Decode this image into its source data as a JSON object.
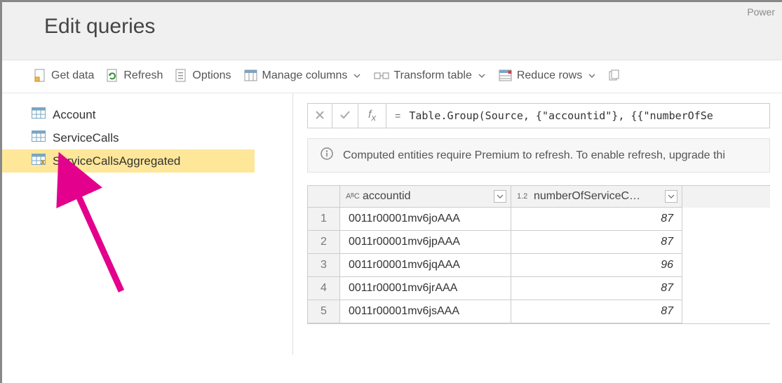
{
  "header": {
    "title": "Edit queries",
    "brand": "Power"
  },
  "toolbar": {
    "get_data": "Get data",
    "refresh": "Refresh",
    "options": "Options",
    "manage_columns": "Manage columns",
    "transform_table": "Transform table",
    "reduce_rows": "Reduce rows"
  },
  "sidebar": {
    "items": [
      {
        "label": "Account"
      },
      {
        "label": "ServiceCalls"
      },
      {
        "label": "ServiceCallsAggregated"
      }
    ],
    "selected_index": 2
  },
  "formula": {
    "eq": "=",
    "text": "Table.Group(Source, {\"accountid\"}, {{\"numberOfSe"
  },
  "info_banner": {
    "text": "Computed entities require Premium to refresh. To enable refresh, upgrade thi"
  },
  "table": {
    "columns": [
      {
        "type_label": "AᴮC",
        "name": "accountid"
      },
      {
        "type_label": "1.2",
        "name": "numberOfServiceC…"
      }
    ],
    "rows": [
      {
        "n": 1,
        "accountid": "0011r00001mv6joAAA",
        "value": 87
      },
      {
        "n": 2,
        "accountid": "0011r00001mv6jpAAA",
        "value": 87
      },
      {
        "n": 3,
        "accountid": "0011r00001mv6jqAAA",
        "value": 96
      },
      {
        "n": 4,
        "accountid": "0011r00001mv6jrAAA",
        "value": 87
      },
      {
        "n": 5,
        "accountid": "0011r00001mv6jsAAA",
        "value": 87
      }
    ]
  }
}
